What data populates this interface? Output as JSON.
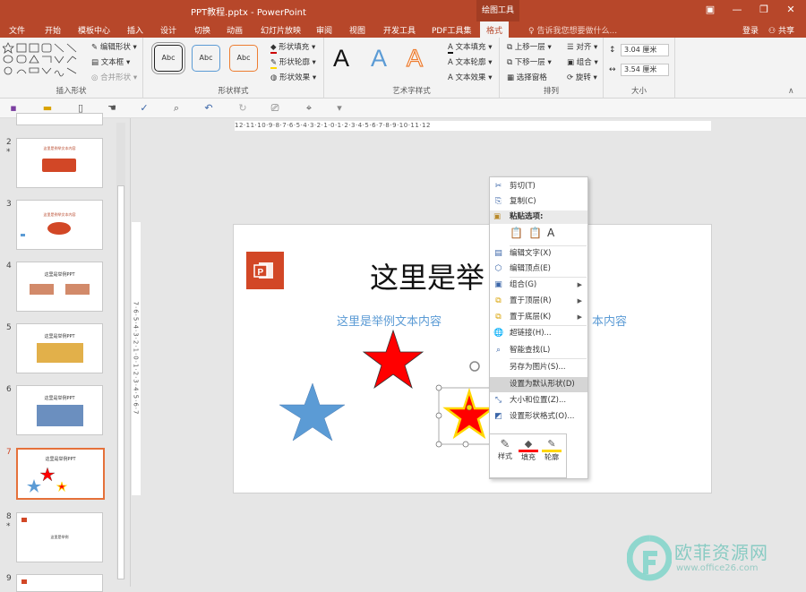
{
  "window": {
    "title": "PPT教程.pptx - PowerPoint",
    "context_tab": "绘图工具"
  },
  "tabs": [
    "文件",
    "开始",
    "模板中心",
    "插入",
    "设计",
    "切换",
    "动画",
    "幻灯片放映",
    "审阅",
    "视图",
    "开发工具",
    "PDF工具集",
    "格式"
  ],
  "active_tab": "格式",
  "help_text": "告诉我您想要做什么...",
  "account": {
    "login": "登录",
    "share": "共享"
  },
  "ribbon": {
    "insert_shapes": {
      "label": "插入形状",
      "edit_shape": "编辑形状",
      "text_box": "文本框",
      "merge_shapes": "合并形状"
    },
    "shape_styles": {
      "label": "形状样式",
      "sample": "Abc",
      "fill": "形状填充",
      "outline": "形状轮廓",
      "effects": "形状效果"
    },
    "wordart": {
      "label": "艺术字样式",
      "sample": "A",
      "text_fill": "文本填充",
      "text_outline": "文本轮廓",
      "text_effects": "文本效果"
    },
    "arrange": {
      "label": "排列",
      "bring_forward": "上移一层",
      "send_backward": "下移一层",
      "selection_pane": "选择窗格",
      "align": "对齐",
      "group": "组合",
      "rotate": "旋转"
    },
    "size": {
      "label": "大小",
      "height": "3.04 厘米",
      "width": "3.54 厘米"
    }
  },
  "ruler": {
    "horizontal": "12·11·10·9·8·7·6·5·4·3·2·1·0·1·2·3·4·5·6·7·8·9·10·11·12",
    "vertical": "7·6·5·4·3·2·1·0·1·2·3·4·5·6·7"
  },
  "slides": [
    {
      "num": "2",
      "star": "*",
      "title": "这里是例举文本内容"
    },
    {
      "num": "3",
      "star": "",
      "title": "这里是例举文本内容"
    },
    {
      "num": "4",
      "star": "",
      "title": "这里是举例PPT"
    },
    {
      "num": "5",
      "star": "",
      "title": "这里是举例PPT"
    },
    {
      "num": "6",
      "star": "",
      "title": "这里是举例PPT"
    },
    {
      "num": "7",
      "star": "",
      "title": "这里是举例PPT"
    },
    {
      "num": "8",
      "star": "*",
      "title": "这里是举例"
    },
    {
      "num": "9",
      "star": "",
      "title": ""
    }
  ],
  "current_slide": {
    "title": "这里是举",
    "subtitle_left": "这里是举例文本内容",
    "subtitle_right": "本内容"
  },
  "context_menu": {
    "cut": "剪切(T)",
    "copy": "复制(C)",
    "paste_header": "粘贴选项:",
    "edit_text": "编辑文字(X)",
    "edit_points": "编辑顶点(E)",
    "group": "组合(G)",
    "bring_to_front": "置于顶层(R)",
    "send_to_back": "置于底层(K)",
    "hyperlink": "超链接(H)...",
    "smart_lookup": "智能查找(L)",
    "save_as_picture": "另存为图片(S)...",
    "set_default_shape": "设置为默认形状(D)",
    "size_position": "大小和位置(Z)...",
    "format_shape": "设置形状格式(O)..."
  },
  "mini_toolbar": {
    "style": "样式",
    "fill": "填充",
    "outline": "轮廓"
  },
  "watermark": {
    "name": "欧菲资源网",
    "url": "www.office26.com"
  },
  "colors": {
    "accent": "#b7472a",
    "star_red": "#ff0000",
    "star_blue": "#5b9bd5",
    "star_outline_yellow": "#ffd700",
    "logo": "#d24726"
  }
}
